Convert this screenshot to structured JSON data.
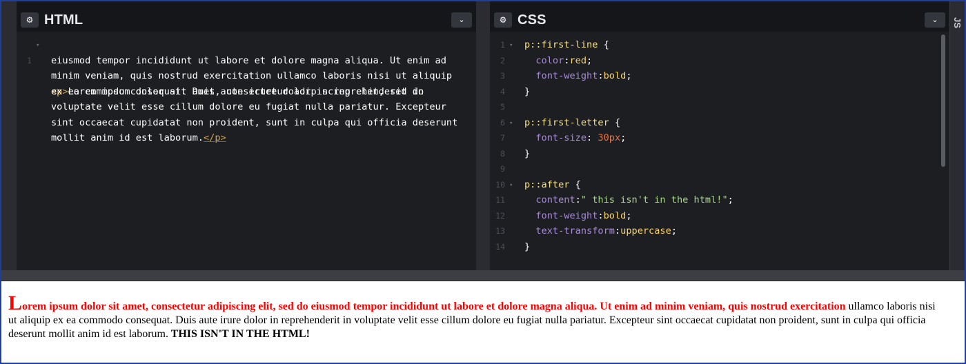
{
  "html_panel": {
    "title": "HTML",
    "code_open_tag": "<p>",
    "code_close_tag": "</p>",
    "code_lines": [
      "Lorem ipsum dolor sit amet, consectetur adipiscing elit, sed do",
      "eiusmod tempor incididunt ut labore et dolore magna aliqua. Ut enim ad",
      "minim veniam, quis nostrud exercitation ullamco laboris nisi ut aliquip",
      "ex ea commodo consequat. Duis aute irure dolor in reprehenderit in",
      "voluptate velit esse cillum dolore eu fugiat nulla pariatur. Excepteur",
      "sint occaecat cupidatat non proident, sunt in culpa qui officia deserunt",
      "mollit anim id est laborum."
    ],
    "line_number": "1"
  },
  "css_panel": {
    "title": "CSS",
    "lines": [
      {
        "n": "1",
        "sel": "p::first-line",
        "brace": " {"
      },
      {
        "n": "2",
        "prop": "color",
        "val": "red"
      },
      {
        "n": "3",
        "prop": "font-weight",
        "val": "bold"
      },
      {
        "n": "4",
        "close": "}"
      },
      {
        "n": "5"
      },
      {
        "n": "6",
        "sel": "p::first-letter",
        "brace": " {"
      },
      {
        "n": "7",
        "prop": "font-size",
        "num": "30px"
      },
      {
        "n": "8",
        "close": "}"
      },
      {
        "n": "9"
      },
      {
        "n": "10",
        "sel": "p::after",
        "brace": " {"
      },
      {
        "n": "11",
        "prop": "content",
        "str": "\" this isn't in the html!\""
      },
      {
        "n": "12",
        "prop": "font-weight",
        "val": "bold"
      },
      {
        "n": "13",
        "prop": "text-transform",
        "val": "uppercase"
      },
      {
        "n": "14",
        "close": "}"
      }
    ]
  },
  "js_tab": {
    "label": "JS"
  },
  "icons": {
    "gear": "gear-icon",
    "chevron": "chevron-down-icon"
  },
  "preview": {
    "first_letter": "L",
    "first_line_rest": "orem ipsum dolor sit amet, consectetur adipiscing elit, sed do eiusmod tempor incididunt ut labore et dolore magna aliqua. Ut enim ad minim veniam, quis nostrud exercitation",
    "rest": " ullamco laboris nisi ut aliquip ex ea commodo consequat. Duis aute irure dolor in reprehenderit in voluptate velit esse cillum dolore eu fugiat nulla pariatur. Excepteur sint occaecat cupidatat non proident, sunt in culpa qui officia deserunt mollit anim id est laborum.",
    "after": " this isn't in the html!"
  },
  "colors": {
    "editor_bg": "#1d1e22",
    "header_bg": "#151619",
    "frame_border": "#1f3f9a",
    "selector": "#f7e289",
    "property": "#a88bd8",
    "value": "#fbd369",
    "number": "#e6754a",
    "string": "#a6d985",
    "tag": "#d0a44f"
  }
}
